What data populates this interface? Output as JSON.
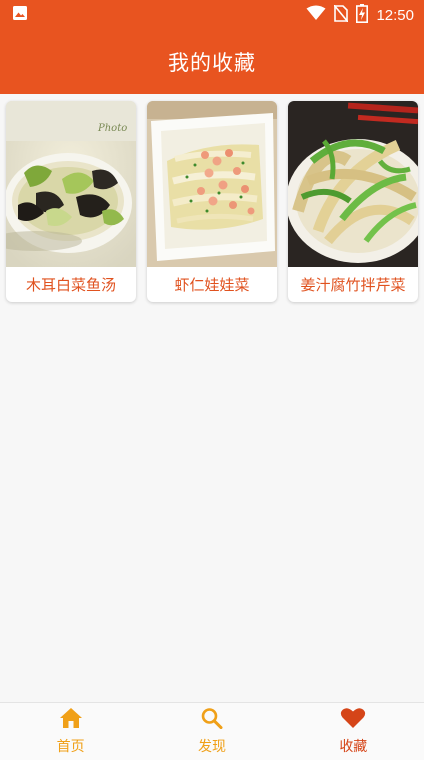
{
  "status_bar": {
    "time": "12:50",
    "icons": [
      "image-notification-icon",
      "wifi-icon",
      "no-sim-icon",
      "battery-charging-icon"
    ]
  },
  "app_bar": {
    "title": "我的收藏"
  },
  "favorites": [
    {
      "name": "木耳白菜鱼汤",
      "image": "soup-with-cabbage-and-fungus"
    },
    {
      "name": "虾仁娃娃菜",
      "image": "shrimp-with-baby-cabbage"
    },
    {
      "name": "姜汁腐竹拌芹菜",
      "image": "tofu-skin-with-celery"
    }
  ],
  "bottom_nav": {
    "items": [
      {
        "label": "首页",
        "icon": "home-icon",
        "active": false
      },
      {
        "label": "发现",
        "icon": "search-icon",
        "active": false
      },
      {
        "label": "收藏",
        "icon": "heart-icon",
        "active": true
      }
    ]
  },
  "colors": {
    "primary": "#e85420",
    "nav_inactive": "#f0a018",
    "nav_active": "#d54518",
    "label": "#e0521f"
  }
}
